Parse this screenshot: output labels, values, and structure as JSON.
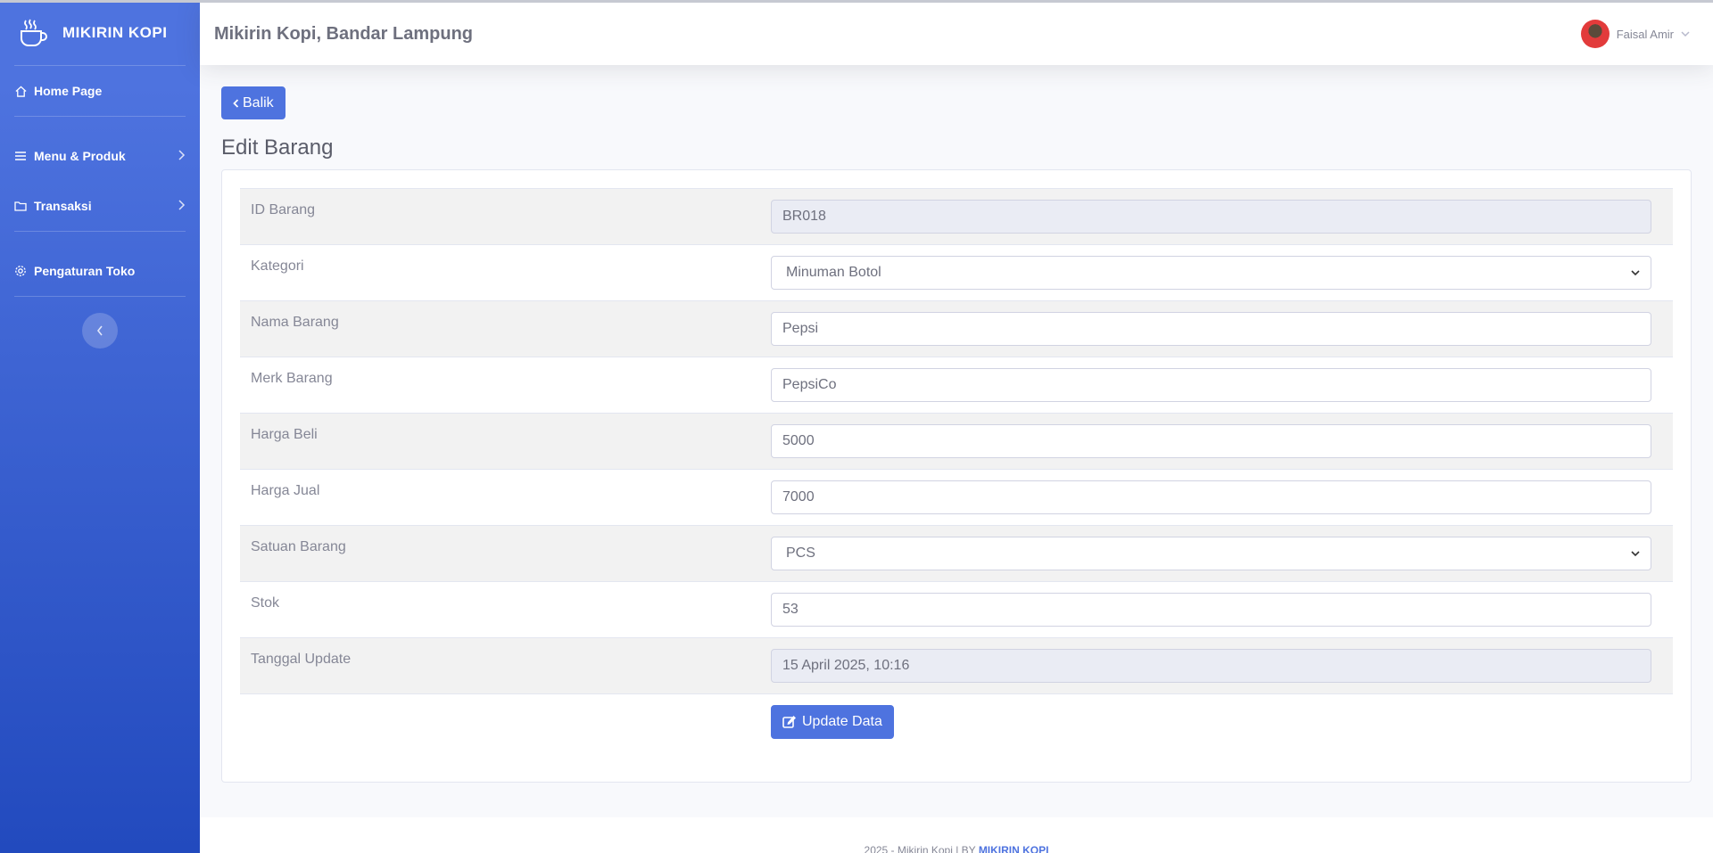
{
  "brand": {
    "name": "MIKIRIN KOPI",
    "icon": "coffee-cup-icon"
  },
  "sidebar": {
    "items": [
      {
        "label": "Home Page",
        "icon": "home-icon"
      },
      {
        "label": "Menu & Produk",
        "icon": "bars-icon"
      },
      {
        "label": "Transaksi",
        "icon": "folder-icon"
      },
      {
        "label": "Pengaturan Toko",
        "icon": "gear-icon"
      }
    ]
  },
  "topbar": {
    "title": "Mikirin Kopi, Bandar Lampung",
    "user_name": "Faisal Amir"
  },
  "main": {
    "back_label": "Balik",
    "page_title": "Edit Barang",
    "fields": [
      {
        "label": "ID Barang",
        "value": "BR018"
      },
      {
        "label": "Kategori",
        "value": "Minuman Botol"
      },
      {
        "label": "Nama Barang",
        "value": "Pepsi"
      },
      {
        "label": "Merk Barang",
        "value": "PepsiCo"
      },
      {
        "label": "Harga Beli",
        "value": "5000"
      },
      {
        "label": "Harga Jual",
        "value": "7000"
      },
      {
        "label": "Satuan Barang",
        "value": "PCS"
      },
      {
        "label": "Stok",
        "value": "53"
      },
      {
        "label": "Tanggal Update",
        "value": "15 April 2025, 10:16"
      }
    ],
    "update_label": "Update Data"
  },
  "footer": {
    "text": "2025 - Mikirin Kopi | BY",
    "link": "MIKIRIN KOPI"
  },
  "colors": {
    "primary": "#4e73df",
    "sidebar_end": "#224abe"
  }
}
